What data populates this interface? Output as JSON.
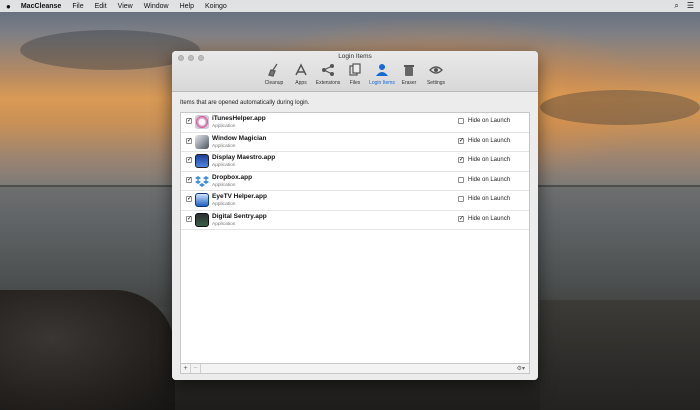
{
  "menubar": {
    "app_name": "MacCleanse",
    "items": [
      "File",
      "Edit",
      "View",
      "Window",
      "Help",
      "Koingo"
    ]
  },
  "window": {
    "title": "Login Items",
    "toolbar": [
      {
        "label": "Cleanup",
        "icon": "broom-icon",
        "active": false
      },
      {
        "label": "Apps",
        "icon": "apps-icon",
        "active": false
      },
      {
        "label": "Extensions",
        "icon": "share-icon",
        "active": false
      },
      {
        "label": "Files",
        "icon": "files-icon",
        "active": false
      },
      {
        "label": "Login Items",
        "icon": "person-icon",
        "active": true
      },
      {
        "label": "Eraser",
        "icon": "trash-icon",
        "active": false
      },
      {
        "label": "Settings",
        "icon": "eye-icon",
        "active": false
      }
    ],
    "description": "Items that are opened automatically during login.",
    "hide_label": "Hide on Launch",
    "items": [
      {
        "name": "iTunesHelper.app",
        "type": "Application",
        "enabled": true,
        "hide": false,
        "icon": "itunes-icon",
        "color": "#e8e8f0"
      },
      {
        "name": "Window Magician",
        "type": "Application",
        "enabled": true,
        "hide": true,
        "icon": "magician-icon",
        "color": "#5a6070"
      },
      {
        "name": "Display Maestro.app",
        "type": "Application",
        "enabled": true,
        "hide": true,
        "icon": "display-icon",
        "color": "#2a4fa8"
      },
      {
        "name": "Dropbox.app",
        "type": "Application",
        "enabled": true,
        "hide": false,
        "icon": "dropbox-icon",
        "color": "#3d8fe0"
      },
      {
        "name": "EyeTV Helper.app",
        "type": "Application",
        "enabled": true,
        "hide": false,
        "icon": "eyetv-icon",
        "color": "#1f5fbf"
      },
      {
        "name": "Digital Sentry.app",
        "type": "Application",
        "enabled": true,
        "hide": true,
        "icon": "sentry-icon",
        "color": "#3b5d47"
      }
    ],
    "bottom": {
      "add": "+",
      "remove": "−",
      "gear": "⚙▾"
    }
  }
}
